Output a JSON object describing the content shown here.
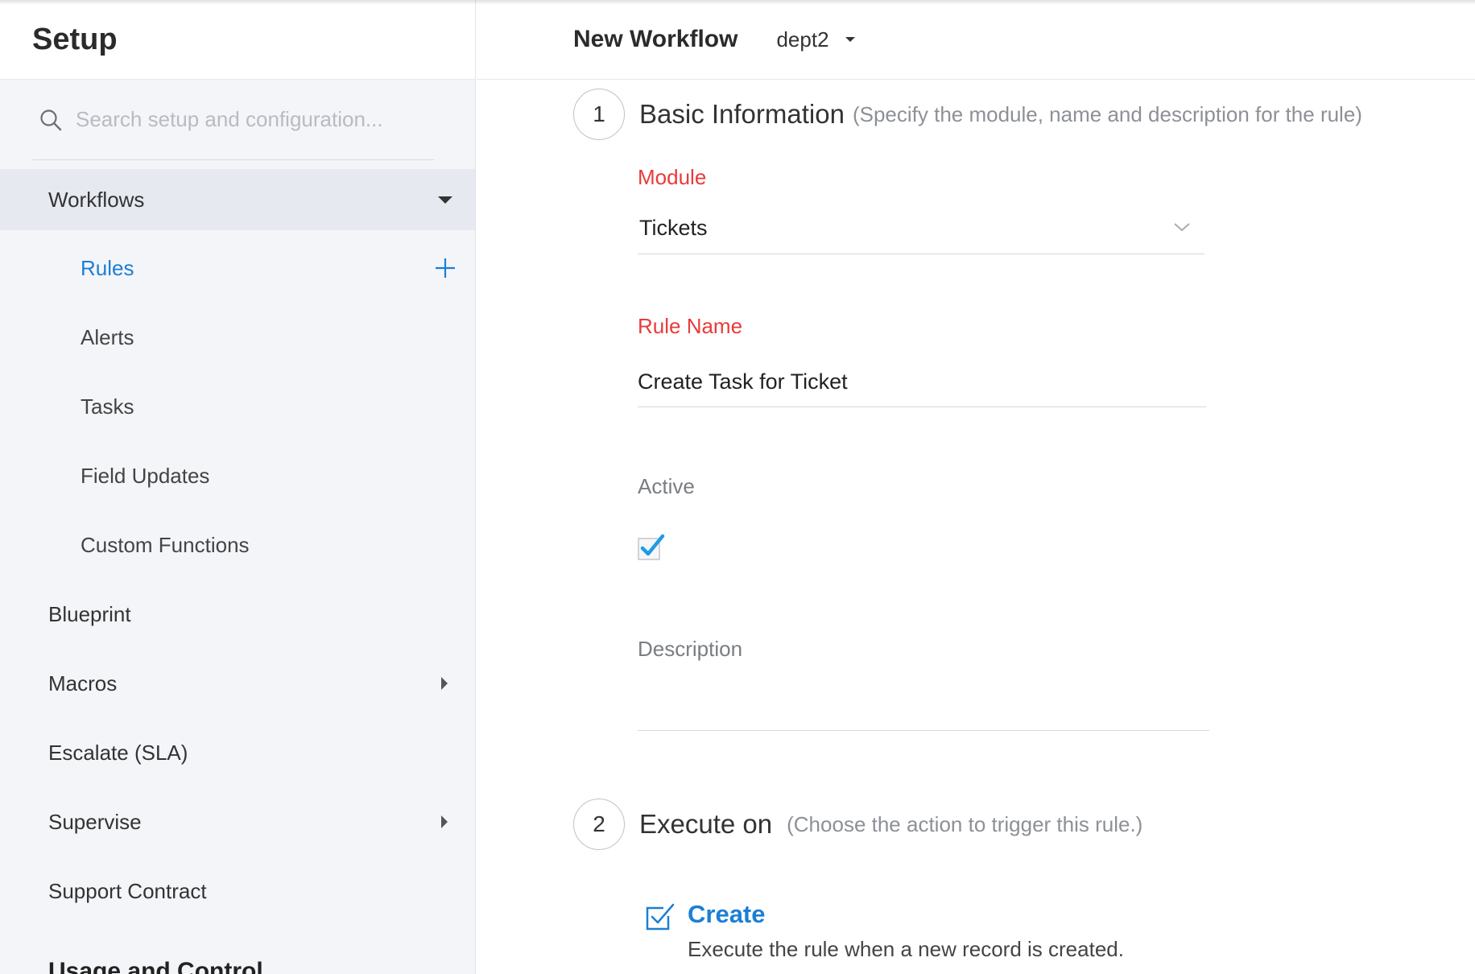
{
  "sidebar": {
    "title": "Setup",
    "search_placeholder": "Search setup and configuration...",
    "items": [
      {
        "label": "Workflows"
      },
      {
        "label": "Rules"
      },
      {
        "label": "Alerts"
      },
      {
        "label": "Tasks"
      },
      {
        "label": "Field Updates"
      },
      {
        "label": "Custom Functions"
      },
      {
        "label": "Blueprint"
      },
      {
        "label": "Macros"
      },
      {
        "label": "Escalate (SLA)"
      },
      {
        "label": "Supervise"
      },
      {
        "label": "Support Contract"
      }
    ],
    "next_section": "Usage and Control"
  },
  "header": {
    "title": "New Workflow",
    "department": "dept2"
  },
  "step1": {
    "number": "1",
    "title": "Basic Information",
    "hint": "(Specify the module, name and description for the rule)",
    "module_label": "Module",
    "module_value": "Tickets",
    "rule_name_label": "Rule Name",
    "rule_name_value": "Create Task for Ticket",
    "active_label": "Active",
    "active_checked": true,
    "description_label": "Description",
    "description_value": ""
  },
  "step2": {
    "number": "2",
    "title": "Execute on",
    "hint": "(Choose the action to trigger this rule.)",
    "trigger_title": "Create",
    "trigger_desc": "Execute the rule when a new record is created."
  },
  "colors": {
    "accent": "#1a7fd6",
    "required": "#ea3a3a",
    "sidebar_bg": "#f4f5f8",
    "sidebar_selected": "#e6e9f0",
    "check": "#1e9be8"
  }
}
